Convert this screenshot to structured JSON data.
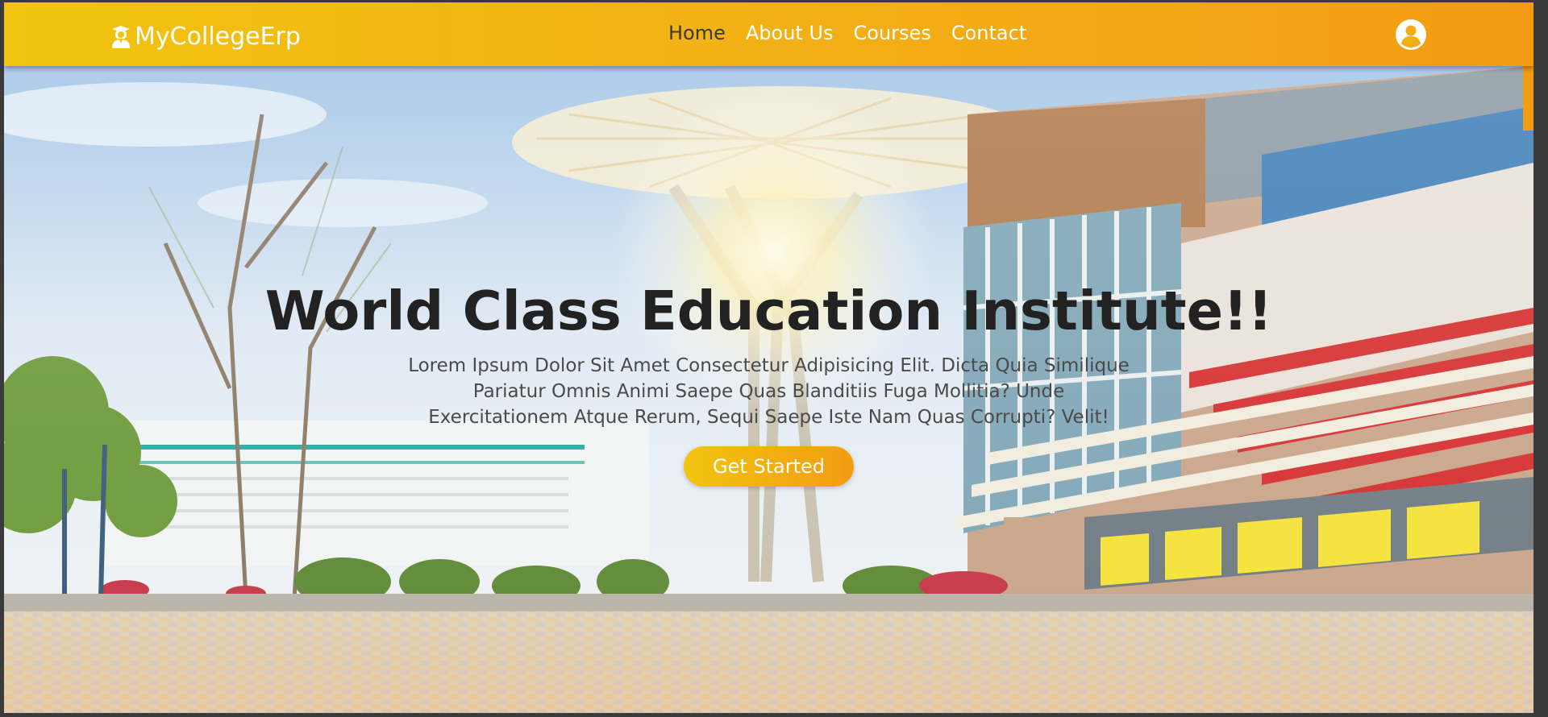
{
  "brand": {
    "name": "MyCollegeErp",
    "icon": "student-graduate-icon"
  },
  "nav": {
    "items": [
      {
        "label": "Home",
        "active": true
      },
      {
        "label": "About Us",
        "active": false
      },
      {
        "label": "Courses",
        "active": false
      },
      {
        "label": "Contact",
        "active": false
      }
    ],
    "user_icon": "user-circle-icon"
  },
  "hero": {
    "title": "World Class Education Institute!!",
    "description_lines": [
      "Lorem Ipsum Dolor Sit Amet Consectetur Adipisicing Elit. Dicta Quia Similique",
      "Pariatur Omnis Animi Saepe Quas Blanditiis Fuga Mollitia? Unde",
      "Exercitationem Atque Rerum, Sequi Saepe Iste Nam Quas Corrupti? Velit!"
    ],
    "cta_label": "Get Started",
    "background": "campus-building-photo"
  },
  "colors": {
    "accent_start": "#f1c40f",
    "accent_end": "#f39c12",
    "title": "#222222",
    "text": "#4a4a4a"
  }
}
